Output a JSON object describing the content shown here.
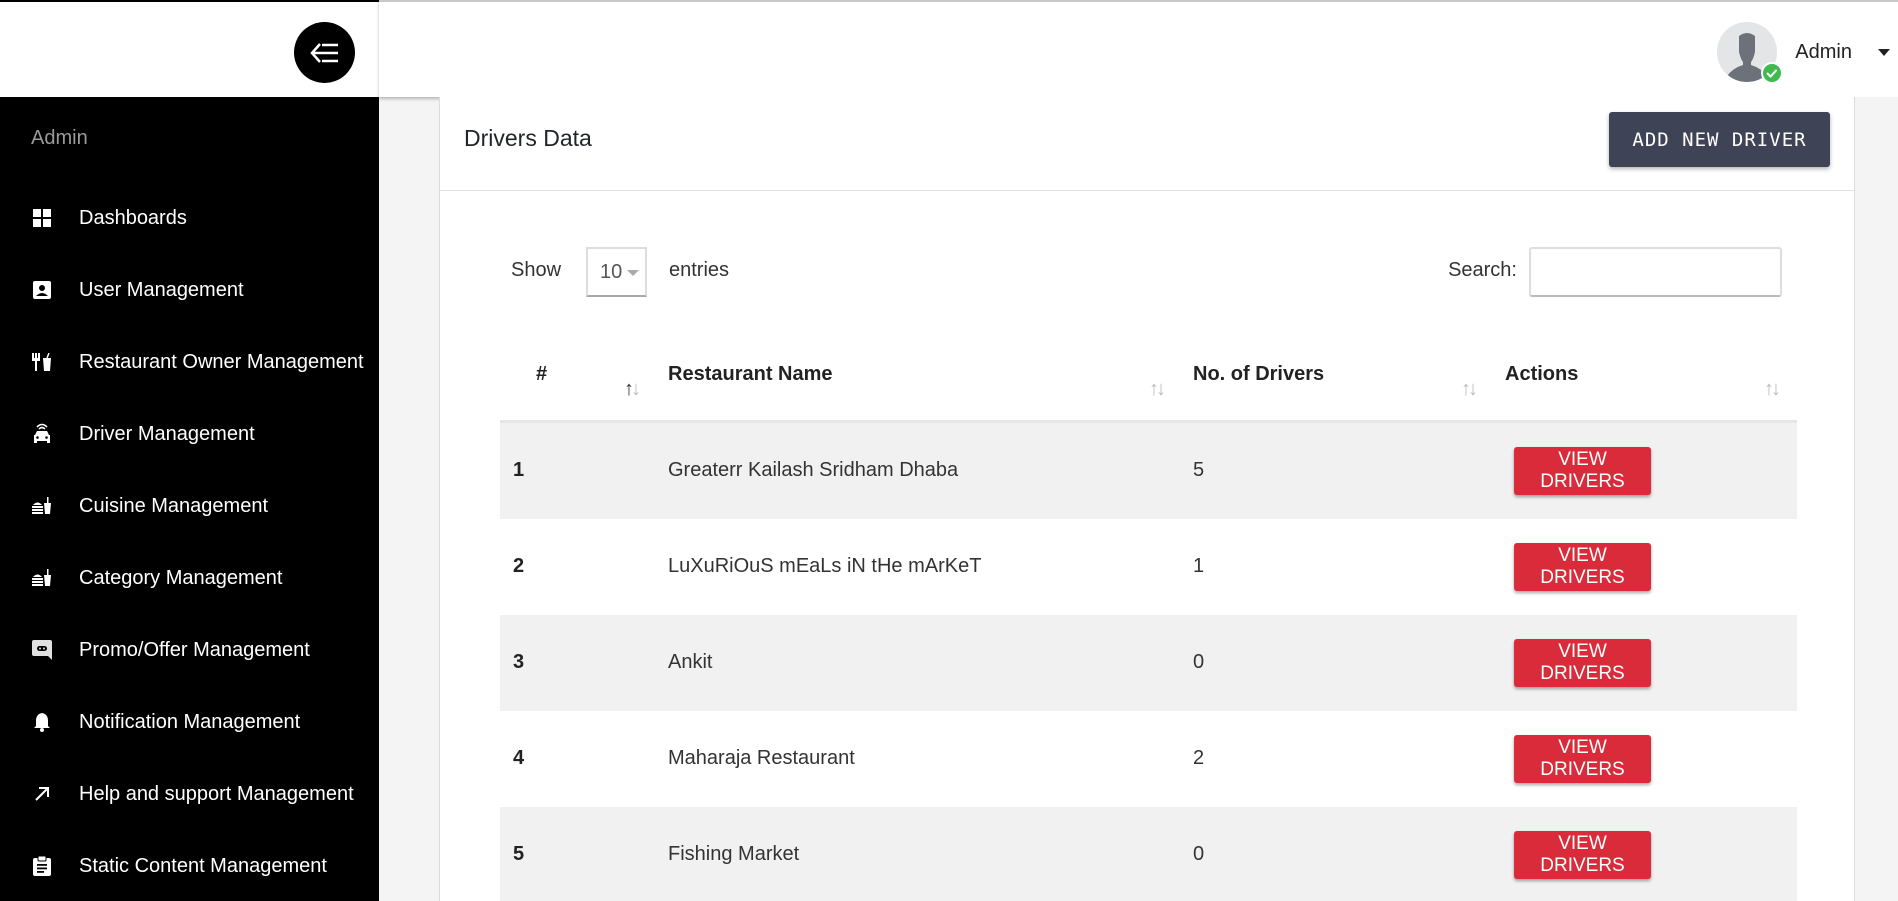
{
  "sidebar": {
    "heading": "Admin",
    "toggle_icon": "menu-collapse-icon",
    "items": [
      {
        "label": "Dashboards",
        "icon": "dashboard-grid-icon"
      },
      {
        "label": "User Management",
        "icon": "user-badge-icon"
      },
      {
        "label": "Restaurant Owner Management",
        "icon": "fork-cup-icon"
      },
      {
        "label": "Driver Management",
        "icon": "connected-car-icon"
      },
      {
        "label": "Cuisine Management",
        "icon": "fastfood-icon"
      },
      {
        "label": "Category Management",
        "icon": "fastfood-icon"
      },
      {
        "label": "Promo/Offer Management",
        "icon": "chat-bubble-icon"
      },
      {
        "label": "Notification Management",
        "icon": "bell-icon"
      },
      {
        "label": "Help and support Management",
        "icon": "arrow-up-right-icon"
      },
      {
        "label": "Static Content Management",
        "icon": "clipboard-icon"
      }
    ]
  },
  "header": {
    "user_name": "Admin",
    "status": "online"
  },
  "card": {
    "title": "Drivers Data",
    "add_button": "ADD NEW DRIVER"
  },
  "controls": {
    "show_label": "Show",
    "entries_value": "10",
    "entries_label": "entries",
    "search_label": "Search:",
    "search_value": ""
  },
  "table": {
    "columns": [
      "#",
      "Restaurant Name",
      "No. of Drivers",
      "Actions"
    ],
    "rows": [
      {
        "index": "1",
        "name": "Greaterr Kailash Sridham Dhaba",
        "drivers": "5",
        "action": "VIEW DRIVERS"
      },
      {
        "index": "2",
        "name": "LuXuRiOuS mEaLs iN tHe mArKeT",
        "drivers": "1",
        "action": "VIEW DRIVERS"
      },
      {
        "index": "3",
        "name": "Ankit",
        "drivers": "0",
        "action": "VIEW DRIVERS"
      },
      {
        "index": "4",
        "name": "Maharaja Restaurant",
        "drivers": "2",
        "action": "VIEW DRIVERS"
      },
      {
        "index": "5",
        "name": "Fishing Market",
        "drivers": "0",
        "action": "VIEW DRIVERS"
      }
    ]
  },
  "colors": {
    "sidebar_bg": "#000000",
    "primary_button": "#3e4355",
    "danger_button": "#d92b3a",
    "online_status": "#3fb950"
  }
}
